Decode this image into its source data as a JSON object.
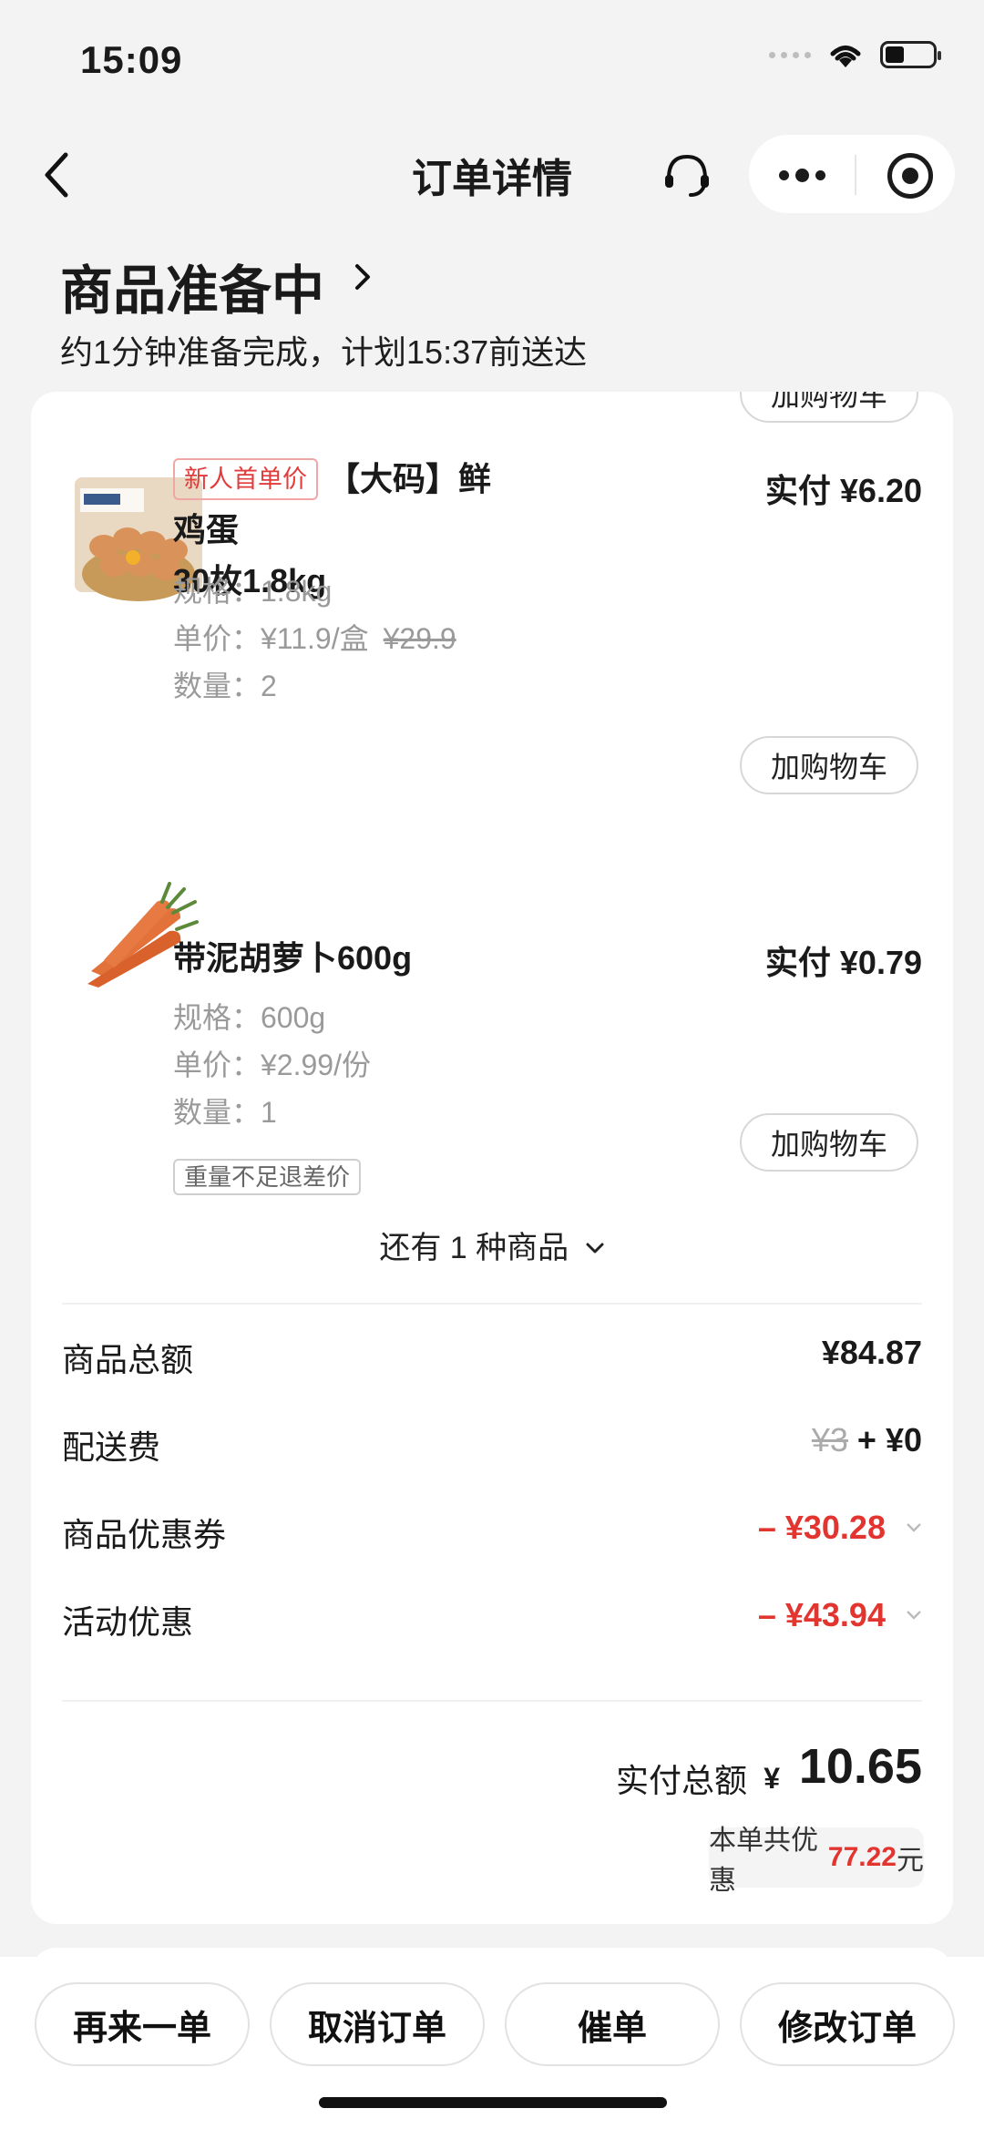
{
  "status_bar": {
    "time": "15:09"
  },
  "nav": {
    "title": "订单详情",
    "icons": [
      "back-icon",
      "customer-service-icon",
      "more-icon",
      "close-mini-program-icon"
    ]
  },
  "order_status": {
    "title": "商品准备中",
    "subtitle": "约1分钟准备完成，计划15:37前送达"
  },
  "products": [
    {
      "tag": "新人首单价",
      "name_line1": "【大码】鲜鸡蛋",
      "name_line2": "30枚1.8kg",
      "price": "实付 ¥6.20",
      "spec": "规格：1.8kg",
      "unit_price": "单价：¥11.9/盒",
      "original_price": "¥29.9",
      "quantity": "数量：2",
      "button": "加购物车"
    },
    {
      "name_line1": "带泥胡萝卜600g",
      "price": "实付 ¥0.79",
      "spec": "规格：600g",
      "unit_price": "单价：¥2.99/份",
      "quantity": "数量：1",
      "weight_tag": "重量不足退差价",
      "button": "加购物车"
    }
  ],
  "partial_button": "加购物车",
  "more_goods": "还有 1 种商品",
  "summary": {
    "goods_total_label": "商品总额",
    "goods_total_value": "¥84.87",
    "delivery_label": "配送费",
    "delivery_original": "¥3",
    "delivery_value": "+ ¥0",
    "coupon_label": "商品优惠券",
    "coupon_value": "– ¥30.28",
    "activity_label": "活动优惠",
    "activity_value": "– ¥43.94"
  },
  "total": {
    "label": "实付总额",
    "currency": "¥",
    "value": "10.65",
    "saving_prefix": "本单共优惠",
    "saving_amount": "77.22",
    "saving_suffix": "元"
  },
  "bottom_actions": [
    "再来一单",
    "取消订单",
    "催单",
    "修改订单"
  ],
  "colors": {
    "accent_red": "#e3352f",
    "background": "#f3f3f4"
  }
}
